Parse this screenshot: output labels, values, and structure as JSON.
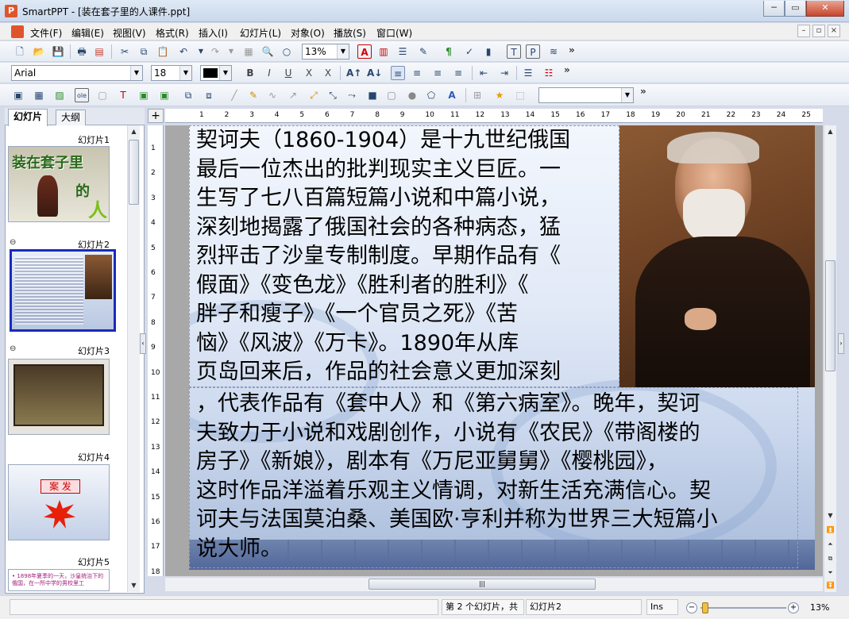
{
  "window": {
    "title": "SmartPPT - [装在套子里的人课件.ppt]",
    "app_icon": "P",
    "min_glyph": "─",
    "max_glyph": "▭",
    "close_glyph": "✕"
  },
  "menu": {
    "items": [
      "文件(F)",
      "编辑(E)",
      "视图(V)",
      "格式(R)",
      "插入(I)",
      "幻灯片(L)",
      "对象(O)",
      "播放(S)",
      "窗口(W)"
    ],
    "mdi_min": "–",
    "mdi_restore": "▫",
    "mdi_close": "×"
  },
  "toolbar1": {
    "zoom": "13%",
    "more": "»"
  },
  "toolbar2": {
    "font": "Arial",
    "size": "18",
    "bold": "B",
    "italic": "I",
    "underline": "U",
    "strike": "X",
    "more": "»"
  },
  "toolbar3": {
    "more": "»"
  },
  "tabs": {
    "slides": "幻灯片",
    "outline": "大纲"
  },
  "thumbnails": [
    {
      "label": "幻灯片1",
      "title": "装在套子里",
      "subtitle": "的",
      "accent": "人"
    },
    {
      "label": "幻灯片2"
    },
    {
      "label": "幻灯片3"
    },
    {
      "label": "幻灯片4",
      "title": "案 发"
    },
    {
      "label": "幻灯片5",
      "preview": "• 1898年夏季的一天，沙皇统治下的俄国，在一所中学的男校里工"
    }
  ],
  "ruler": {
    "h": [
      "1",
      "2",
      "3",
      "4",
      "5",
      "6",
      "7",
      "8",
      "9",
      "10",
      "11",
      "12",
      "13",
      "14",
      "15",
      "16",
      "17",
      "18",
      "19",
      "20",
      "21",
      "22",
      "23",
      "24",
      "25"
    ],
    "v": [
      "1",
      "2",
      "3",
      "4",
      "5",
      "6",
      "7",
      "8",
      "9",
      "10",
      "11",
      "12",
      "13",
      "14",
      "15",
      "16",
      "17",
      "18"
    ],
    "corner": "+"
  },
  "slide": {
    "lines1": [
      "契诃夫（1860-1904）是十九世纪俄国",
      "最后一位杰出的批判现实主义巨匠。一",
      "生写了七八百篇短篇小说和中篇小说，",
      "深刻地揭露了俄国社会的各种病态，猛",
      "烈抨击了沙皇专制制度。早期作品有《",
      "假面》《变色龙》《胜利者的胜利》《",
      "胖子和瘦子》《一个官员之死》《苦",
      "恼》《风波》《万卡》。1890年从库",
      "页岛回来后，作品的社会意义更加深刻"
    ],
    "lines2": [
      "，代表作品有《套中人》和《第六病室》。晚年，契诃",
      "夫致力于小说和戏剧创作，小说有《农民》《带阁楼的",
      "房子》《新娘》，剧本有《万尼亚舅舅》《樱桃园》，",
      "这时作品洋溢着乐观主义情调，对新生活充满信心。契",
      "诃夫与法国莫泊桑、美国欧·亨利并称为世界三大短篇小",
      "说大师。"
    ]
  },
  "status": {
    "page": "第 2 个幻灯片，共",
    "slide_name": "幻灯片2",
    "mode": "Ins",
    "zoom": "13%"
  },
  "colors": {
    "accent": "#1a2bb8",
    "app": "#e0542b"
  }
}
